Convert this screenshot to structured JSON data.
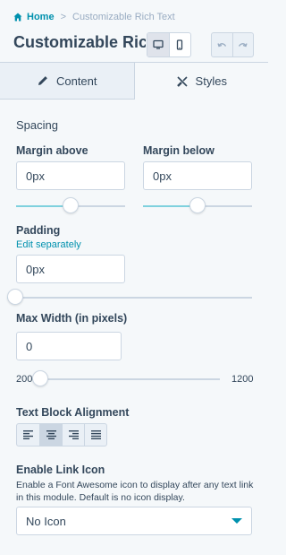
{
  "breadcrumb": {
    "home_label": "Home",
    "separator": ">",
    "current_label": "Customizable Rich Text"
  },
  "header": {
    "title": "Customizable Ric..."
  },
  "tabs": [
    {
      "label": "Content",
      "icon": "pencil-icon",
      "active": false
    },
    {
      "label": "Styles",
      "icon": "brush-icon",
      "active": true
    }
  ],
  "styles": {
    "spacing_label": "Spacing",
    "margin_above": {
      "label": "Margin above",
      "value": "0px",
      "slider_fraction": 0.5
    },
    "margin_below": {
      "label": "Margin below",
      "value": "0px",
      "slider_fraction": 0.5
    },
    "padding": {
      "label": "Padding",
      "edit_link": "Edit separately",
      "value": "0px",
      "slider_fraction": 0
    },
    "max_width": {
      "label": "Max Width (in pixels)",
      "value": "0",
      "min_label": "200",
      "max_label": "1200",
      "slider_fraction": 0
    },
    "text_alignment": {
      "label": "Text Block Alignment",
      "options": [
        "left",
        "center",
        "right",
        "justify"
      ],
      "selected": "center"
    },
    "link_icon": {
      "label": "Enable Link Icon",
      "help": "Enable a Font Awesome icon to display after any text link in this module. Default is no icon display.",
      "selected": "No Icon"
    }
  },
  "colors": {
    "accent": "#0091ae",
    "text": "#33475b",
    "border": "#cbd6e2",
    "slider_fill": "#7fd1de",
    "background": "#f5f8fa"
  }
}
